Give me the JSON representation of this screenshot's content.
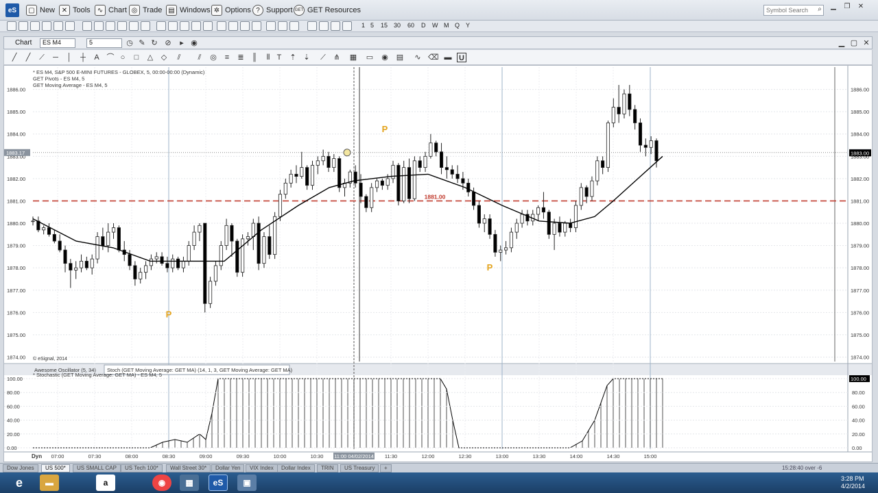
{
  "menubar": {
    "logo": "eS",
    "items": [
      "New",
      "Tools",
      "Chart",
      "Trade",
      "Windows",
      "Options",
      "Support",
      "GET Resources"
    ],
    "search_placeholder": "Symbol Search"
  },
  "toolbar": {
    "intervals": [
      "1",
      "5",
      "15",
      "30",
      "60",
      "D",
      "W",
      "M",
      "Q",
      "Y"
    ]
  },
  "chart_window": {
    "title": "Chart",
    "symbol": "ES M4",
    "interval": "5"
  },
  "chart_data": {
    "type": "candlestick",
    "legend": [
      "* ES M4, S&P 500 E-MINI FUTURES - GLOBEX, 5, 00:00-00:00 (Dynamic)",
      "GET Pivots - ES M4, 5",
      "GET Moving Average - ES M4, 5"
    ],
    "copyright": "© eSignal, 2014",
    "price_ticks": [
      "1886.00",
      "1885.00",
      "1884.00",
      "1883.00",
      "1882.00",
      "1881.00",
      "1880.00",
      "1879.00",
      "1878.00",
      "1877.00",
      "1876.00",
      "1875.00",
      "1874.00"
    ],
    "ylim": [
      1873.8,
      1887.0
    ],
    "time_ticks": [
      "07:00",
      "07:30",
      "08:00",
      "08:30",
      "09:00",
      "09:30",
      "10:00",
      "10:30",
      "11:00 04/02/2014",
      "11:30",
      "12:00",
      "12:30",
      "13:00",
      "13:30",
      "14:00",
      "14:30",
      "15:00"
    ],
    "cursor_price_label": "1883.17",
    "last_price_label": "1883.00",
    "pivot_line": {
      "value": 1881.0,
      "label": "1881.00",
      "color": "#c0392b"
    },
    "pivot_markers": [
      {
        "label": "P",
        "time": "08:30",
        "price": 1875.9
      },
      {
        "label": "P",
        "time": "11:25",
        "price": 1884.2
      },
      {
        "label": "P",
        "time": "12:50",
        "price": 1878.0
      }
    ],
    "candles": [
      [
        1880.1,
        1880.3,
        1879.9,
        1880.1
      ],
      [
        1880.1,
        1880.3,
        1879.6,
        1879.7
      ],
      [
        1879.7,
        1879.9,
        1879.5,
        1879.8
      ],
      [
        1879.8,
        1880.0,
        1879.4,
        1879.5
      ],
      [
        1879.5,
        1879.7,
        1879.1,
        1879.2
      ],
      [
        1879.2,
        1879.5,
        1878.7,
        1878.8
      ],
      [
        1878.8,
        1879.0,
        1877.8,
        1878.2
      ],
      [
        1878.2,
        1878.4,
        1877.1,
        1877.9
      ],
      [
        1877.9,
        1878.3,
        1877.5,
        1878.0
      ],
      [
        1878.0,
        1878.6,
        1877.8,
        1878.3
      ],
      [
        1878.3,
        1878.5,
        1877.9,
        1878.0
      ],
      [
        1878.0,
        1878.6,
        1877.7,
        1878.4
      ],
      [
        1878.4,
        1879.6,
        1878.2,
        1879.4
      ],
      [
        1879.4,
        1879.8,
        1878.8,
        1879.0
      ],
      [
        1879.0,
        1880.0,
        1878.7,
        1879.6
      ],
      [
        1879.6,
        1880.0,
        1879.3,
        1879.8
      ],
      [
        1879.8,
        1879.9,
        1878.7,
        1878.8
      ],
      [
        1878.8,
        1879.2,
        1878.3,
        1878.6
      ],
      [
        1878.6,
        1878.8,
        1877.9,
        1878.1
      ],
      [
        1878.1,
        1878.3,
        1877.2,
        1877.5
      ],
      [
        1877.5,
        1878.0,
        1877.3,
        1877.8
      ],
      [
        1877.8,
        1878.3,
        1877.5,
        1878.1
      ],
      [
        1878.1,
        1878.6,
        1877.9,
        1878.4
      ],
      [
        1878.4,
        1878.7,
        1878.2,
        1878.5
      ],
      [
        1878.5,
        1878.7,
        1878.1,
        1878.2
      ],
      [
        1878.2,
        1878.5,
        1877.8,
        1878.0
      ],
      [
        1878.0,
        1878.6,
        1877.8,
        1878.4
      ],
      [
        1878.4,
        1878.5,
        1877.9,
        1878.0
      ],
      [
        1878.0,
        1878.5,
        1877.8,
        1878.3
      ],
      [
        1878.3,
        1879.2,
        1878.1,
        1879.0
      ],
      [
        1879.0,
        1879.9,
        1878.8,
        1879.6
      ],
      [
        1879.6,
        1880.0,
        1879.2,
        1879.9
      ],
      [
        1880.0,
        1880.0,
        1876.0,
        1876.4
      ],
      [
        1876.4,
        1877.6,
        1876.2,
        1877.4
      ],
      [
        1877.4,
        1878.3,
        1877.2,
        1878.1
      ],
      [
        1878.1,
        1879.2,
        1877.9,
        1879.0
      ],
      [
        1879.0,
        1880.2,
        1878.8,
        1879.9
      ],
      [
        1879.9,
        1880.0,
        1878.5,
        1879.2
      ],
      [
        1879.2,
        1879.3,
        1877.6,
        1877.8
      ],
      [
        1877.8,
        1879.5,
        1877.6,
        1879.3
      ],
      [
        1879.3,
        1879.6,
        1879.0,
        1879.4
      ],
      [
        1879.4,
        1880.2,
        1878.8,
        1880.0
      ],
      [
        1880.0,
        1880.3,
        1877.9,
        1878.2
      ],
      [
        1878.2,
        1879.6,
        1878.0,
        1879.4
      ],
      [
        1879.4,
        1879.9,
        1878.4,
        1878.6
      ],
      [
        1878.6,
        1880.5,
        1878.4,
        1880.3
      ],
      [
        1880.3,
        1881.5,
        1880.1,
        1881.3
      ],
      [
        1881.3,
        1882.0,
        1881.1,
        1881.8
      ],
      [
        1881.8,
        1882.4,
        1881.6,
        1882.2
      ],
      [
        1882.2,
        1882.6,
        1881.8,
        1882.1
      ],
      [
        1882.1,
        1883.2,
        1882.0,
        1882.5
      ],
      [
        1882.5,
        1882.6,
        1881.5,
        1881.7
      ],
      [
        1881.7,
        1882.8,
        1881.5,
        1882.6
      ],
      [
        1882.6,
        1883.0,
        1882.2,
        1882.8
      ],
      [
        1882.8,
        1883.3,
        1882.6,
        1883.0
      ],
      [
        1883.0,
        1883.2,
        1882.3,
        1882.5
      ],
      [
        1882.5,
        1883.1,
        1882.3,
        1882.9
      ],
      [
        1882.9,
        1883.0,
        1881.4,
        1881.6
      ],
      [
        1881.6,
        1882.0,
        1881.2,
        1881.8
      ],
      [
        1881.8,
        1882.4,
        1881.6,
        1882.3
      ],
      [
        1882.3,
        1882.6,
        1881.6,
        1881.8
      ],
      [
        1881.8,
        1882.2,
        1880.9,
        1881.2
      ],
      [
        1881.2,
        1881.3,
        1880.5,
        1880.7
      ],
      [
        1880.7,
        1881.8,
        1880.5,
        1881.6
      ],
      [
        1881.6,
        1882.0,
        1881.4,
        1881.9
      ],
      [
        1881.9,
        1882.0,
        1881.5,
        1881.7
      ],
      [
        1881.7,
        1882.2,
        1881.5,
        1882.0
      ],
      [
        1882.0,
        1882.8,
        1881.8,
        1882.6
      ],
      [
        1882.6,
        1882.7,
        1880.8,
        1881.0
      ],
      [
        1881.0,
        1882.8,
        1880.9,
        1882.5
      ],
      [
        1882.5,
        1882.9,
        1880.9,
        1881.1
      ],
      [
        1881.1,
        1883.0,
        1881.0,
        1882.8
      ],
      [
        1882.8,
        1883.0,
        1882.3,
        1882.5
      ],
      [
        1882.5,
        1883.2,
        1882.3,
        1883.0
      ],
      [
        1883.0,
        1884.0,
        1882.9,
        1883.6
      ],
      [
        1883.6,
        1883.7,
        1883.0,
        1883.2
      ],
      [
        1883.2,
        1883.6,
        1882.2,
        1882.5
      ],
      [
        1882.5,
        1883.0,
        1882.0,
        1882.4
      ],
      [
        1882.4,
        1882.6,
        1882.0,
        1882.2
      ],
      [
        1882.2,
        1882.6,
        1881.8,
        1882.0
      ],
      [
        1882.0,
        1882.3,
        1881.5,
        1881.8
      ],
      [
        1881.8,
        1882.0,
        1881.2,
        1881.4
      ],
      [
        1881.4,
        1881.6,
        1880.6,
        1880.8
      ],
      [
        1880.8,
        1881.0,
        1879.8,
        1880.0
      ],
      [
        1880.0,
        1880.4,
        1879.6,
        1880.2
      ],
      [
        1880.2,
        1880.4,
        1879.3,
        1879.5
      ],
      [
        1879.5,
        1879.7,
        1878.5,
        1878.7
      ],
      [
        1878.7,
        1879.0,
        1878.3,
        1878.8
      ],
      [
        1878.8,
        1879.2,
        1878.6,
        1878.9
      ],
      [
        1878.9,
        1879.8,
        1878.7,
        1879.6
      ],
      [
        1879.6,
        1880.2,
        1879.3,
        1880.0
      ],
      [
        1880.0,
        1880.6,
        1879.8,
        1880.4
      ],
      [
        1880.4,
        1880.6,
        1879.9,
        1880.1
      ],
      [
        1880.1,
        1880.6,
        1879.9,
        1880.4
      ],
      [
        1880.4,
        1880.8,
        1880.1,
        1880.7
      ],
      [
        1880.7,
        1881.4,
        1880.2,
        1880.5
      ],
      [
        1880.5,
        1880.6,
        1879.3,
        1879.5
      ],
      [
        1879.5,
        1880.2,
        1878.8,
        1880.0
      ],
      [
        1880.0,
        1880.3,
        1879.4,
        1879.6
      ],
      [
        1879.6,
        1880.1,
        1879.4,
        1880.0
      ],
      [
        1880.0,
        1880.2,
        1879.6,
        1879.8
      ],
      [
        1879.8,
        1881.0,
        1879.6,
        1880.8
      ],
      [
        1880.8,
        1881.8,
        1880.6,
        1881.6
      ],
      [
        1881.6,
        1881.7,
        1880.9,
        1881.2
      ],
      [
        1881.2,
        1882.1,
        1881.0,
        1881.9
      ],
      [
        1881.9,
        1883.0,
        1881.7,
        1882.8
      ],
      [
        1882.8,
        1883.0,
        1882.2,
        1882.5
      ],
      [
        1882.5,
        1884.6,
        1882.3,
        1884.5
      ],
      [
        1884.5,
        1885.6,
        1884.3,
        1885.2
      ],
      [
        1885.2,
        1886.2,
        1884.5,
        1884.9
      ],
      [
        1884.9,
        1886.0,
        1884.7,
        1885.8
      ],
      [
        1885.8,
        1886.2,
        1884.8,
        1885.1
      ],
      [
        1885.1,
        1885.3,
        1884.2,
        1884.5
      ],
      [
        1884.5,
        1884.7,
        1883.2,
        1883.5
      ],
      [
        1883.5,
        1883.8,
        1883.0,
        1883.4
      ],
      [
        1883.4,
        1883.9,
        1883.1,
        1883.7
      ],
      [
        1883.7,
        1883.8,
        1882.5,
        1882.8
      ]
    ],
    "time_range": [
      "06:40",
      "15:10"
    ],
    "moving_average": [
      [
        "06:40",
        1880.2
      ],
      [
        "07:15",
        1879.2
      ],
      [
        "07:45",
        1878.9
      ],
      [
        "08:15",
        1878.3
      ],
      [
        "08:45",
        1878.3
      ],
      [
        "09:15",
        1878.3
      ],
      [
        "09:45",
        1879.7
      ],
      [
        "10:15",
        1880.8
      ],
      [
        "10:40",
        1881.6
      ],
      [
        "11:00",
        1881.9
      ],
      [
        "11:30",
        1882.1
      ],
      [
        "12:00",
        1882.2
      ],
      [
        "12:30",
        1881.6
      ],
      [
        "13:00",
        1880.8
      ],
      [
        "13:30",
        1880.1
      ],
      [
        "13:55",
        1880.0
      ],
      [
        "14:15",
        1880.3
      ],
      [
        "14:30",
        1881.0
      ],
      [
        "14:50",
        1882.0
      ],
      [
        "15:10",
        1883.0
      ]
    ],
    "session_lines_times": [
      "08:30",
      "11:00",
      "13:00",
      "15:00"
    ],
    "oscillator_tabs": [
      "Awesome Oscillator (5, 34)",
      "Stoch (GET Moving Average: GET MA) (14, 1, 3, GET Moving Average: GET MA)"
    ],
    "oscillator_legend": "* Stochastic (GET Moving Average: GET MA) - ES M4, 5",
    "oscillator_ticks": [
      "100.00",
      "80.00",
      "60.00",
      "40.00",
      "20.00",
      "0.00"
    ],
    "oscillator_last": "100.00",
    "oscillator_ylim": [
      -2,
      102
    ],
    "stochastic": [
      [
        "06:40",
        0
      ],
      [
        "07:30",
        0
      ],
      [
        "08:15",
        0
      ],
      [
        "08:25",
        8
      ],
      [
        "08:35",
        12
      ],
      [
        "08:45",
        8
      ],
      [
        "08:55",
        20
      ],
      [
        "09:00",
        12
      ],
      [
        "09:05",
        50
      ],
      [
        "09:10",
        100
      ],
      [
        "12:10",
        100
      ],
      [
        "12:15",
        85
      ],
      [
        "12:20",
        40
      ],
      [
        "12:25",
        0
      ],
      [
        "13:55",
        0
      ],
      [
        "14:05",
        10
      ],
      [
        "14:15",
        40
      ],
      [
        "14:25",
        90
      ],
      [
        "14:30",
        100
      ],
      [
        "15:10",
        100
      ]
    ]
  },
  "bottom_bar": {
    "dyn_label": "Dyn",
    "tabs": [
      "Dow Jones",
      "US 500*",
      "US SMALL CAP",
      "US Tech 100*",
      "Wall Street 30*",
      "Dollar Yen",
      "VIX Index",
      "Dollar Index",
      "TRIN",
      "US Treasury"
    ],
    "active_tab": "US 500*",
    "status_text": "15:28:40 over -6"
  },
  "taskbar": {
    "time": "3:28 PM",
    "date": "4/2/2014"
  }
}
